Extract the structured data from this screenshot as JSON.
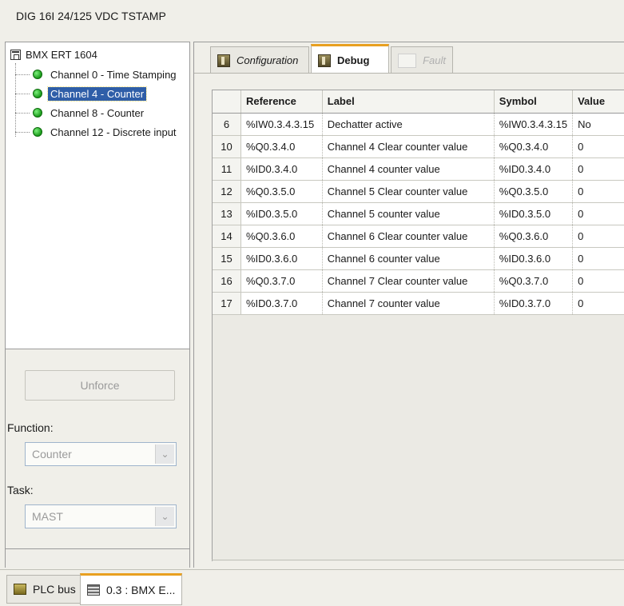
{
  "window": {
    "title": "DIG 16I 24/125 VDC TSTAMP"
  },
  "tree": {
    "root": "BMX ERT 1604",
    "items": [
      {
        "label": "Channel 0 - Time Stamping",
        "selected": false
      },
      {
        "label": "Channel 4 - Counter",
        "selected": true
      },
      {
        "label": "Channel 8 - Counter",
        "selected": false
      },
      {
        "label": "Channel 12 - Discrete input",
        "selected": false
      }
    ]
  },
  "controls": {
    "unforce_label": "Unforce",
    "function_label": "Function:",
    "function_value": "Counter",
    "task_label": "Task:",
    "task_value": "MAST"
  },
  "tabs": [
    {
      "label": "Configuration",
      "active": false,
      "disabled": false
    },
    {
      "label": "Debug",
      "active": true,
      "disabled": false
    },
    {
      "label": "Fault",
      "active": false,
      "disabled": true
    }
  ],
  "table": {
    "columns": [
      "Reference",
      "Label",
      "Symbol",
      "Value"
    ],
    "rows": [
      {
        "num": "6",
        "reference": "%IW0.3.4.3.15",
        "label": "Dechatter active",
        "symbol": "%IW0.3.4.3.15",
        "value": "No"
      },
      {
        "num": "10",
        "reference": "%Q0.3.4.0",
        "label": "Channel 4 Clear counter value",
        "symbol": "%Q0.3.4.0",
        "value": "0"
      },
      {
        "num": "11",
        "reference": "%ID0.3.4.0",
        "label": "Channel 4 counter value",
        "symbol": "%ID0.3.4.0",
        "value": "0"
      },
      {
        "num": "12",
        "reference": "%Q0.3.5.0",
        "label": "Channel 5 Clear counter value",
        "symbol": "%Q0.3.5.0",
        "value": "0"
      },
      {
        "num": "13",
        "reference": "%ID0.3.5.0",
        "label": "Channel 5 counter value",
        "symbol": "%ID0.3.5.0",
        "value": "0"
      },
      {
        "num": "14",
        "reference": "%Q0.3.6.0",
        "label": "Channel 6 Clear counter value",
        "symbol": "%Q0.3.6.0",
        "value": "0"
      },
      {
        "num": "15",
        "reference": "%ID0.3.6.0",
        "label": "Channel 6 counter value",
        "symbol": "%ID0.3.6.0",
        "value": "0"
      },
      {
        "num": "16",
        "reference": "%Q0.3.7.0",
        "label": "Channel 7 Clear counter value",
        "symbol": "%Q0.3.7.0",
        "value": "0"
      },
      {
        "num": "17",
        "reference": "%ID0.3.7.0",
        "label": "Channel 7 counter value",
        "symbol": "%ID0.3.7.0",
        "value": "0"
      }
    ]
  },
  "bottom_tabs": [
    {
      "label": "PLC bus",
      "icon": "plc-bus-icon",
      "active": false
    },
    {
      "label": "0.3 : BMX E...",
      "icon": "module-doc-icon",
      "active": true
    }
  ],
  "colors": {
    "selection": "#2f5ea8",
    "active_tab_accent": "#e8a020",
    "led_green": "#1a9a1a"
  }
}
